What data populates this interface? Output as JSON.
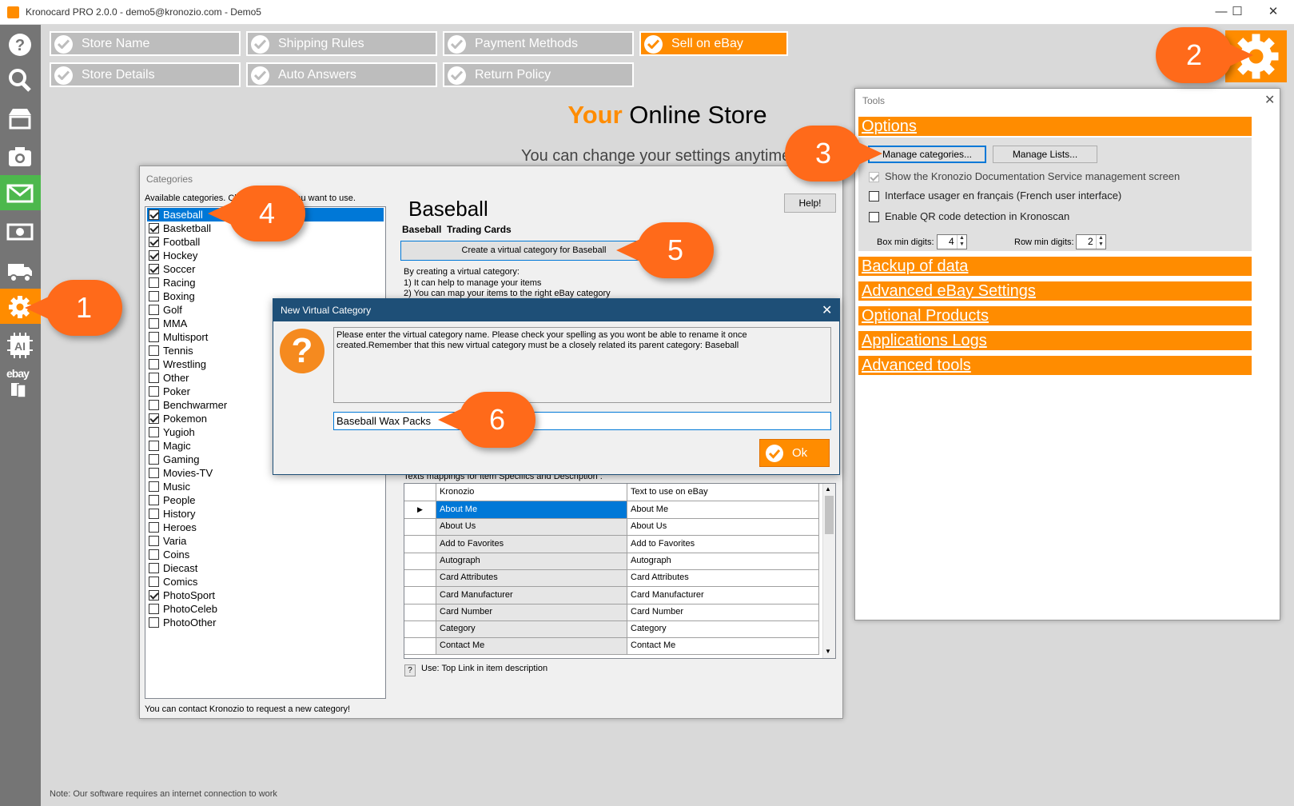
{
  "window": {
    "title": "Kronocard PRO 2.0.0 - demo5@kronozio.com - Demo5",
    "minimize": "—",
    "maximize": "☐",
    "close": "✕"
  },
  "tabs": [
    {
      "label": "Store Name",
      "selected": false
    },
    {
      "label": "Shipping Rules",
      "selected": false
    },
    {
      "label": "Payment Methods",
      "selected": false
    },
    {
      "label": "Sell on eBay",
      "selected": true
    },
    {
      "label": "Store Details",
      "selected": false
    },
    {
      "label": "Auto Answers",
      "selected": false
    },
    {
      "label": "Return Policy",
      "selected": false
    }
  ],
  "main": {
    "heading_your": "Your",
    "heading_rest": " Online Store",
    "subtext": "You can change your settings anytime",
    "footnote": "Note: Our software requires an internet connection to work"
  },
  "sidebar": {
    "ebay_label": "ebay",
    "ai_label": "AI"
  },
  "tools": {
    "title": "Tools",
    "close": "✕",
    "sections": [
      "Options",
      "Backup of data",
      "Advanced eBay Settings",
      "Optional Products",
      "Applications Logs",
      "Advanced tools"
    ],
    "manage_categories": "Manage categories...",
    "manage_lists": "Manage Lists...",
    "opt_show_doc": "Show the Kronozio Documentation Service management screen",
    "opt_french": "Interface usager en français (French user interface)",
    "opt_qr": "Enable QR code detection in Kronoscan",
    "box_min_label": "Box min digits:",
    "box_min_value": "4",
    "row_min_label": "Row min digits:",
    "row_min_value": "2"
  },
  "categories": {
    "title": "Categories",
    "available": "Available categories. Check the ones you want to use.",
    "help": "Help!",
    "selected_name": "Baseball",
    "selected_full": "Baseball  Trading Cards",
    "create_virtual": "Create a virtual category for Baseball",
    "virtual_intro": "By creating a virtual category:",
    "virtual_1": "1) It can help to manage your items",
    "virtual_2": "2) You can map your items to the right eBay category",
    "mappings_label": "Texts mappings for item Specifics and Description :",
    "col_kronozio": "Kronozio",
    "col_ebay": "Text to use on eBay",
    "use_hint": "Use: Top Link in item description",
    "hint_icon": "?",
    "contact": "You can contact Kronozio to request a new category!",
    "list": [
      {
        "name": "Baseball",
        "checked": true
      },
      {
        "name": "Basketball",
        "checked": true
      },
      {
        "name": "Football",
        "checked": true
      },
      {
        "name": "Hockey",
        "checked": true
      },
      {
        "name": "Soccer",
        "checked": true
      },
      {
        "name": "Racing",
        "checked": false
      },
      {
        "name": "Boxing",
        "checked": false
      },
      {
        "name": "Golf",
        "checked": false
      },
      {
        "name": "MMA",
        "checked": false
      },
      {
        "name": "Multisport",
        "checked": false
      },
      {
        "name": "Tennis",
        "checked": false
      },
      {
        "name": "Wrestling",
        "checked": false
      },
      {
        "name": "Other",
        "checked": false
      },
      {
        "name": "Poker",
        "checked": false
      },
      {
        "name": "Benchwarmer",
        "checked": false
      },
      {
        "name": "Pokemon",
        "checked": true
      },
      {
        "name": "Yugioh",
        "checked": false
      },
      {
        "name": "Magic",
        "checked": false
      },
      {
        "name": "Gaming",
        "checked": false
      },
      {
        "name": "Movies-TV",
        "checked": false
      },
      {
        "name": "Music",
        "checked": false
      },
      {
        "name": "People",
        "checked": false
      },
      {
        "name": "History",
        "checked": false
      },
      {
        "name": "Heroes",
        "checked": false
      },
      {
        "name": "Varia",
        "checked": false
      },
      {
        "name": "Coins",
        "checked": false
      },
      {
        "name": "Diecast",
        "checked": false
      },
      {
        "name": "Comics",
        "checked": false
      },
      {
        "name": "PhotoSport",
        "checked": true
      },
      {
        "name": "PhotoCeleb",
        "checked": false
      },
      {
        "name": "PhotoOther",
        "checked": false
      }
    ],
    "mappings": [
      {
        "k": "About Me",
        "v": "About Me"
      },
      {
        "k": "About Us",
        "v": "About Us"
      },
      {
        "k": "Add to Favorites",
        "v": "Add to Favorites"
      },
      {
        "k": "Autograph",
        "v": "Autograph"
      },
      {
        "k": "Card Attributes",
        "v": "Card Attributes"
      },
      {
        "k": "Card Manufacturer",
        "v": "Card Manufacturer"
      },
      {
        "k": "Card Number",
        "v": "Card Number"
      },
      {
        "k": "Category",
        "v": "Category"
      },
      {
        "k": "Contact Me",
        "v": "Contact Me"
      }
    ]
  },
  "virtual_dialog": {
    "title": "New Virtual Category",
    "close": "✕",
    "message": "Please enter the virtual category name. Please check your spelling as you wont be able to rename it once created.Remember that this new virtual category must be a closely related its parent category: Baseball",
    "input_value": "Baseball Wax Packs",
    "ok": "Ok",
    "icon": "?"
  },
  "callouts": [
    "1",
    "2",
    "3",
    "4",
    "5",
    "6"
  ],
  "colors": {
    "accent": "#ff8c00",
    "callout": "#ff6a1a",
    "dialog_bar": "#1e4f77",
    "selection": "#0078d7"
  }
}
